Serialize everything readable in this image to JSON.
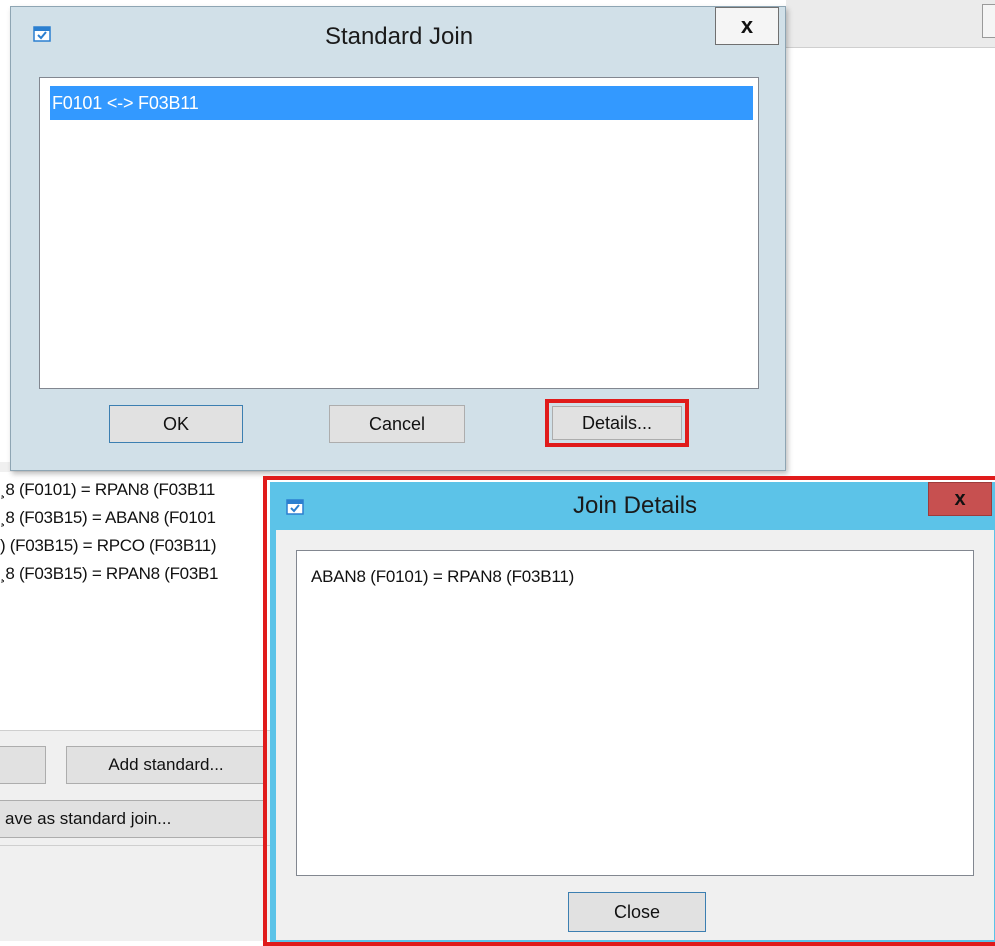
{
  "background_window": {
    "join_lines": [
      "¸8 (F0101) = RPAN8 (F03B11",
      "¸8 (F03B15) = ABAN8 (F0101",
      ") (F03B15) = RPCO (F03B11)",
      "¸8 (F03B15) = RPAN8 (F03B1"
    ],
    "add_standard_label": "Add standard...",
    "save_as_standard_label": "ave as standard join..."
  },
  "standard_join_dialog": {
    "title": "Standard Join",
    "close_glyph": "x",
    "joins": [
      "F0101 <-> F03B11"
    ],
    "ok_label": "OK",
    "cancel_label": "Cancel",
    "details_label": "Details..."
  },
  "join_details_dialog": {
    "title": "Join Details",
    "close_glyph": "x",
    "detail_text": "ABAN8 (F0101) = RPAN8 (F03B11)",
    "close_button_label": "Close"
  },
  "colors": {
    "highlight_outline": "#e01b1b",
    "selection": "#3399ff",
    "join_details_titlebar": "#5cc3e8",
    "standard_join_titlebar": "#d1e0e8"
  }
}
